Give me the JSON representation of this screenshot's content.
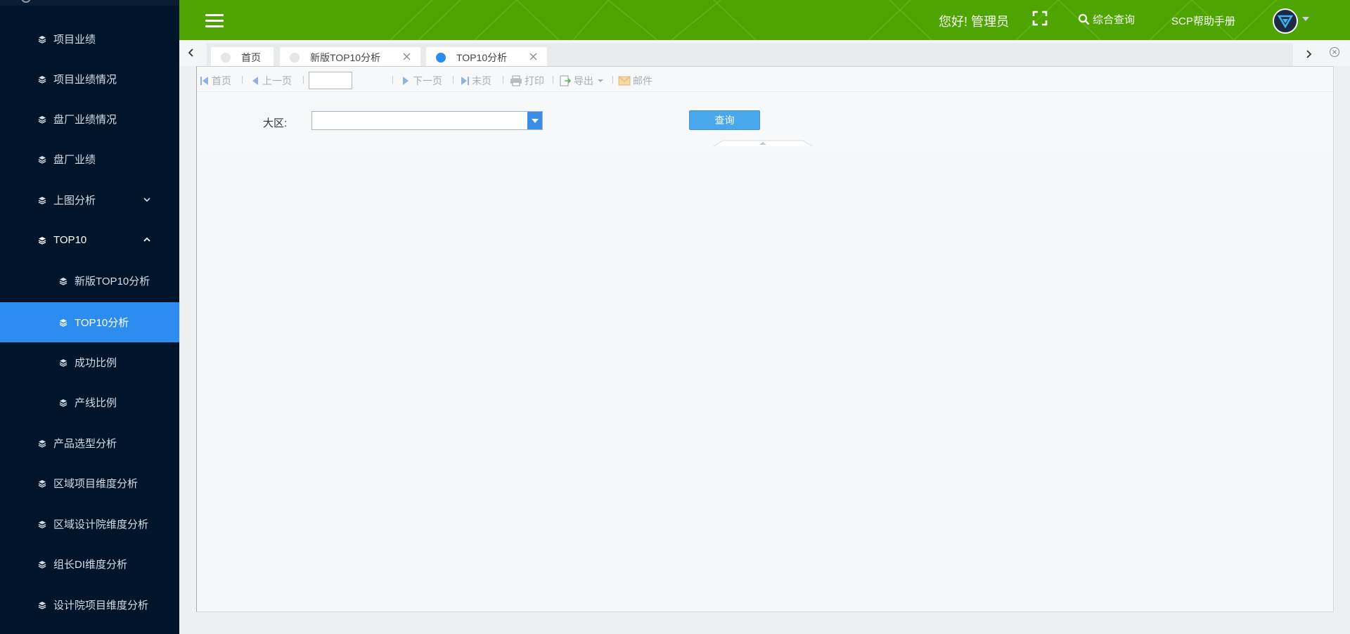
{
  "sidebar": {
    "items": [
      {
        "label": "项目业绩"
      },
      {
        "label": "项目业绩情况"
      },
      {
        "label": "盘厂业绩情况"
      },
      {
        "label": "盘厂业绩"
      },
      {
        "label": "上图分析"
      },
      {
        "label": "TOP10"
      },
      {
        "label": "新版TOP10分析"
      },
      {
        "label": "TOP10分析"
      },
      {
        "label": "成功比例"
      },
      {
        "label": "产线比例"
      },
      {
        "label": "产品选型分析"
      },
      {
        "label": "区域项目维度分析"
      },
      {
        "label": "区域设计院维度分析"
      },
      {
        "label": "组长DI维度分析"
      },
      {
        "label": "设计院项目维度分析"
      }
    ],
    "active_color": "#2d8cf0",
    "bg_color": "#001529"
  },
  "header": {
    "greeting": "您好! 管理员",
    "search_label": "综合查询",
    "help_label": "SCP帮助手册",
    "brand_color": "#4ea400"
  },
  "tabs": [
    {
      "label": "首页"
    },
    {
      "label": "新版TOP10分析"
    },
    {
      "label": "TOP10分析"
    }
  ],
  "toolbar": {
    "first_page": "首页",
    "prev_page": "上一页",
    "next_page": "下一页",
    "last_page": "末页",
    "print": "打印",
    "export": "导出",
    "mail": "邮件",
    "page_value": ""
  },
  "filter": {
    "region_label": "大区:",
    "region_value": "",
    "query_button": "查询"
  }
}
